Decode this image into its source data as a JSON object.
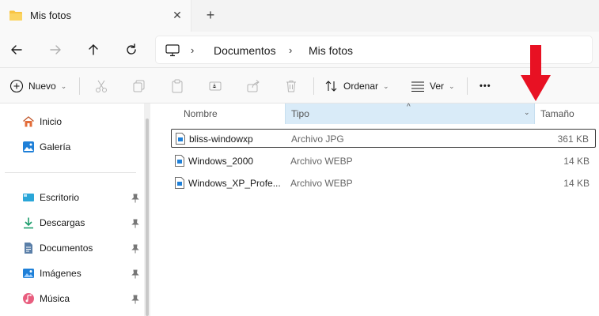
{
  "tab": {
    "title": "Mis fotos",
    "close": "✕",
    "new_tab": "+"
  },
  "address": {
    "crumbs": [
      "Documentos",
      "Mis fotos"
    ],
    "separator": "›"
  },
  "commands": {
    "nuevo": "Nuevo",
    "ordenar": "Ordenar",
    "ver": "Ver",
    "more": "•••",
    "chevron": "⌄"
  },
  "sidebar": {
    "items": [
      {
        "label": "Inicio",
        "icon": "home-icon",
        "pinned": false
      },
      {
        "label": "Galería",
        "icon": "gallery-icon",
        "pinned": false
      },
      {
        "label": "Escritorio",
        "icon": "desktop-icon",
        "pinned": true
      },
      {
        "label": "Descargas",
        "icon": "download-icon",
        "pinned": true
      },
      {
        "label": "Documentos",
        "icon": "document-icon",
        "pinned": true
      },
      {
        "label": "Imágenes",
        "icon": "pictures-icon",
        "pinned": true
      },
      {
        "label": "Música",
        "icon": "music-icon",
        "pinned": true
      }
    ]
  },
  "columns": {
    "nombre": "Nombre",
    "tipo": "Tipo",
    "tamano": "Tamaño",
    "sort_caret": "^",
    "dropdown": "⌄"
  },
  "files": [
    {
      "name": "bliss-windowxp",
      "type": "Archivo JPG",
      "size": "361 KB",
      "selected": true
    },
    {
      "name": "Windows_2000",
      "type": "Archivo WEBP",
      "size": "14 KB",
      "selected": false
    },
    {
      "name": "Windows_XP_Profe...",
      "type": "Archivo WEBP",
      "size": "14 KB",
      "selected": false
    }
  ],
  "colors": {
    "accent": "#0067c0",
    "selected_column": "#d9ebf8",
    "annotation_arrow": "#e81123",
    "folder": "#f8c443"
  }
}
